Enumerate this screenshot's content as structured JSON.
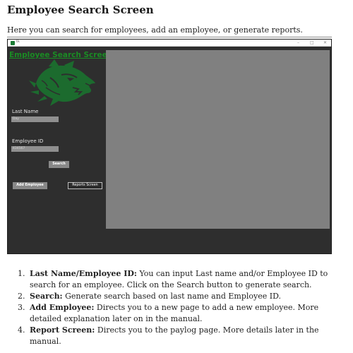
{
  "document": {
    "title": "Employee Search Screen",
    "intro": "Here you can search for employees, add an employee, or generate reports."
  },
  "window": {
    "icon": "app-logo-icon",
    "title_text": "tk",
    "controls": {
      "minimize": "–",
      "maximize": "□",
      "close": "✕"
    }
  },
  "app": {
    "heading": "Employee Search Screen",
    "mascot": "wolf-mascot-icon",
    "last_name_label": "Last Name",
    "last_name_value": "Day",
    "employee_id_label": "Employee ID",
    "employee_id_value": "434567",
    "search_button": "Search",
    "add_employee_button": "Add Employee",
    "reports_screen_button": "Reports Screen"
  },
  "colors": {
    "heading_green": "#1a8c24",
    "mascot_green": "#1c6b2e",
    "app_background": "#2e2e2e",
    "results_panel": "#808080"
  },
  "steps": [
    {
      "num": "1.",
      "title": "Last Name/Employee ID:",
      "text": " You can input Last name and/or Employee ID to search for an employee. Click on the Search button to generate search."
    },
    {
      "num": "2.",
      "title": "Search:",
      "text": " Generate search based on last name and Employee ID."
    },
    {
      "num": "3.",
      "title": "Add Employee:",
      "text": " Directs you to a new page to add a new employee. More detailed explanation later on in the manual."
    },
    {
      "num": "4.",
      "title": "Report Screen:",
      "text": " Directs you to the paylog page. More details later in the manual."
    }
  ]
}
